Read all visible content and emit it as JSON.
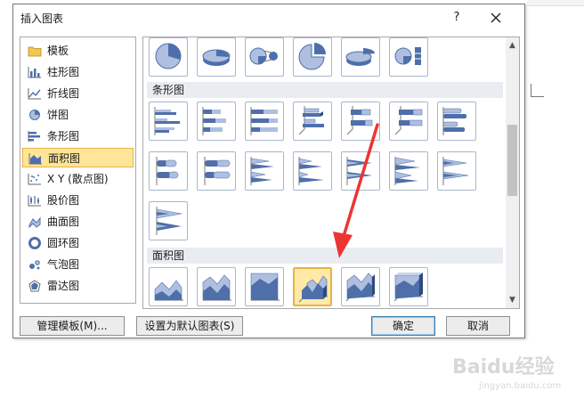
{
  "dialog": {
    "title": "插入图表",
    "help_label": "?"
  },
  "categories": [
    {
      "label": "模板",
      "icon": "folder-icon",
      "selected": false
    },
    {
      "label": "柱形图",
      "icon": "column-chart-icon",
      "selected": false
    },
    {
      "label": "折线图",
      "icon": "line-chart-icon",
      "selected": false
    },
    {
      "label": "饼图",
      "icon": "pie-chart-icon",
      "selected": false
    },
    {
      "label": "条形图",
      "icon": "bar-chart-icon",
      "selected": false
    },
    {
      "label": "面积图",
      "icon": "area-chart-icon",
      "selected": true
    },
    {
      "label": "X Y (散点图)",
      "icon": "scatter-chart-icon",
      "selected": false
    },
    {
      "label": "股价图",
      "icon": "stock-chart-icon",
      "selected": false
    },
    {
      "label": "曲面图",
      "icon": "surface-chart-icon",
      "selected": false
    },
    {
      "label": "圆环图",
      "icon": "doughnut-chart-icon",
      "selected": false
    },
    {
      "label": "气泡图",
      "icon": "bubble-chart-icon",
      "selected": false
    },
    {
      "label": "雷达图",
      "icon": "radar-chart-icon",
      "selected": false
    }
  ],
  "sections": {
    "bar": "条形图",
    "area": "面积图"
  },
  "buttons": {
    "manage_templates": "管理模板(M)...",
    "set_default": "设置为默认图表(S)",
    "ok": "确定",
    "cancel": "取消"
  },
  "watermark": {
    "main": "Baidu经验",
    "sub": "jingyan.baidu.com"
  },
  "colors": {
    "selected_fill": "#ffe598",
    "selected_border": "#e6b445",
    "chart_blue": "#4f6faa",
    "chart_light": "#aebfdf",
    "annotation_arrow": "#ee3333"
  }
}
